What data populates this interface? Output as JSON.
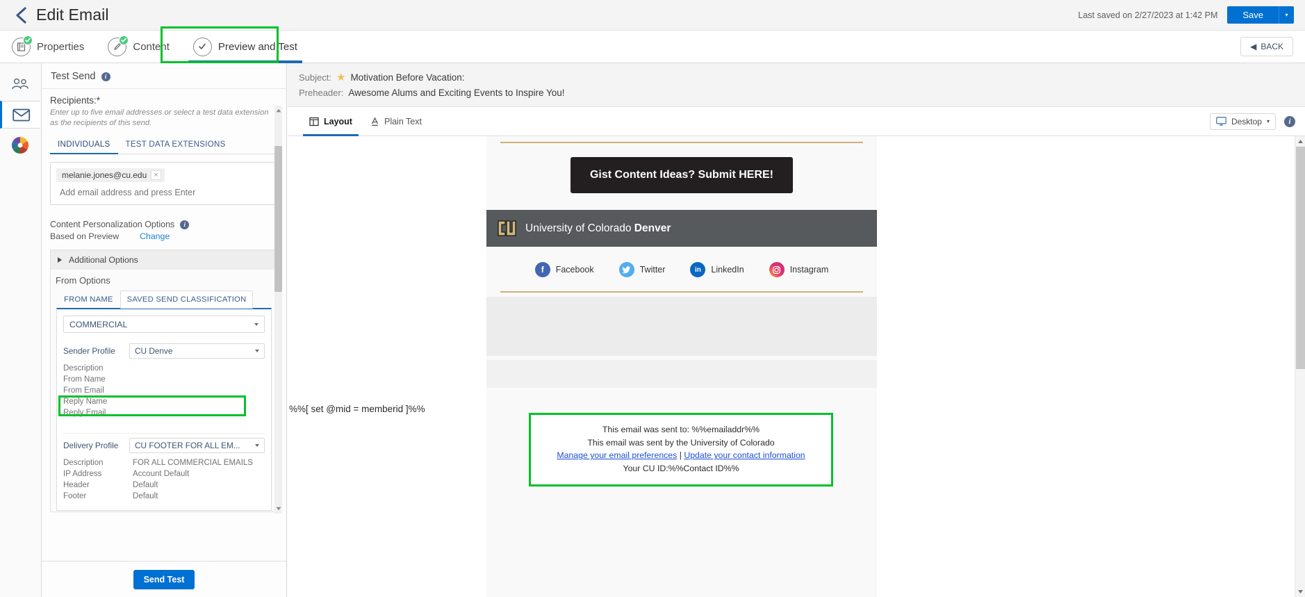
{
  "header": {
    "back_icon": "chevron-left-icon",
    "title": "Edit Email",
    "last_saved": "Last saved on 2/27/2023 at 1:42 PM",
    "save_label": "Save",
    "save_caret": "▾"
  },
  "wizard": {
    "tabs": [
      {
        "label": "Properties",
        "icon": "properties-icon",
        "complete": true,
        "active": false
      },
      {
        "label": "Content",
        "icon": "pencil-icon",
        "complete": true,
        "active": false
      },
      {
        "label": "Preview and Test",
        "icon": "check-circle-icon",
        "complete": false,
        "active": true
      }
    ],
    "back_button": "BACK",
    "back_arrow": "◀"
  },
  "rail": {
    "items": [
      {
        "name": "audience-icon"
      },
      {
        "name": "email-icon",
        "selected": true
      },
      {
        "name": "color-wheel-icon"
      }
    ]
  },
  "test_send": {
    "title": "Test Send",
    "recipients_label": "Recipients:*",
    "recipients_help": "Enter up to five email addresses or select a test data extension as the recipients of this send.",
    "sub_tabs": [
      {
        "label": "INDIVIDUALS",
        "active": true
      },
      {
        "label": "TEST DATA EXTENSIONS",
        "active": false
      }
    ],
    "chip_email": "melanie.jones@cu.edu",
    "chip_remove": "×",
    "add_email_placeholder": "Add email address and press Enter",
    "personalization_label": "Content Personalization Options",
    "based_on": "Based on Preview",
    "change_link": "Change",
    "additional_options": "Additional Options",
    "from_options_title": "From Options",
    "from_tabs": [
      {
        "label": "FROM NAME",
        "active": false
      },
      {
        "label": "SAVED SEND CLASSIFICATION",
        "active": true
      }
    ],
    "classification_value": "COMMERCIAL",
    "sender_profile_label": "Sender Profile",
    "sender_profile_value": "CU Denve",
    "sender_fields": [
      {
        "key": "Description",
        "value": ""
      },
      {
        "key": "From Name",
        "value": ""
      },
      {
        "key": "From Email",
        "value": ""
      },
      {
        "key": "Reply Name",
        "value": ""
      },
      {
        "key": "Reply Email",
        "value": ""
      }
    ],
    "delivery_profile_label": "Delivery Profile",
    "delivery_profile_value": "CU FOOTER FOR ALL EM...",
    "delivery_fields": [
      {
        "key": "Description",
        "value": "FOR ALL COMMERCIAL EMAILS"
      },
      {
        "key": "IP Address",
        "value": "Account Default"
      },
      {
        "key": "Header",
        "value": "Default"
      },
      {
        "key": "Footer",
        "value": "Default"
      }
    ],
    "send_test_label": "Send Test"
  },
  "preview": {
    "subject_key": "Subject:",
    "subject_value": "Motivation Before Vacation:",
    "subject_star": "★",
    "preheader_key": "Preheader:",
    "preheader_value": "Awesome Alums and Exciting Events to Inspire You!",
    "view_tabs": [
      {
        "label": "Layout",
        "icon": "layout-icon",
        "active": true
      },
      {
        "label": "Plain Text",
        "icon": "text-A-icon",
        "active": false
      }
    ],
    "device_label": "Desktop",
    "device_icon": "monitor-icon",
    "device_caret": "▾",
    "info_icon": "info-icon"
  },
  "email": {
    "cta_label": "Gist Content Ideas? Submit HERE!",
    "brand_line_plain": "University of Colorado ",
    "brand_line_bold": "Denver",
    "cu_logo": "cu-logo-icon",
    "social": [
      {
        "label": "Facebook",
        "glyph": "f",
        "color": "#4267b2",
        "icon": "facebook-icon"
      },
      {
        "label": "Twitter",
        "glyph": "t",
        "color": "#55acee",
        "icon": "twitter-icon"
      },
      {
        "label": "LinkedIn",
        "glyph": "in",
        "color": "#0a66c2",
        "icon": "linkedin-icon"
      },
      {
        "label": "Instagram",
        "glyph": "o",
        "color": "#e1306c",
        "icon": "instagram-icon"
      }
    ],
    "ampscript": "%%[ set @mid = memberid ]%%",
    "footer_line1": "This email was sent to: %%emailaddr%%",
    "footer_line2": "This email was sent by the University of Colorado",
    "footer_link1": "Manage your email preferences",
    "footer_sep": " | ",
    "footer_link2": "Update your contact information",
    "footer_line4": "Your CU ID:%%Contact ID%%"
  },
  "colors": {
    "accent_blue": "#0070d2",
    "highlight_green": "#00c12b",
    "cu_gold": "#cbb177",
    "cu_grey": "#565a5c"
  }
}
